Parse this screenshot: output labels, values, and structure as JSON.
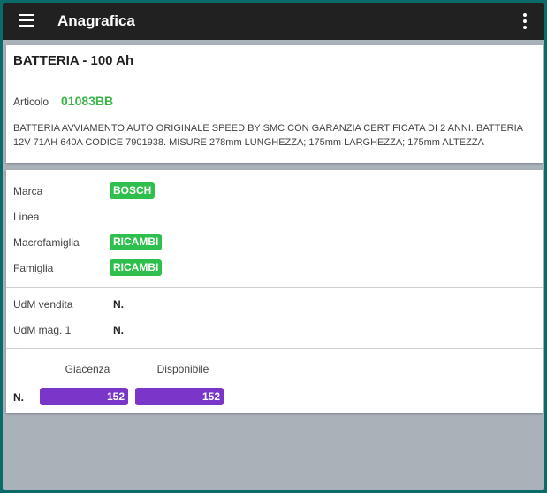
{
  "appbar": {
    "title": "Anagrafica",
    "menu_icon": "hamburger-menu-icon",
    "more_icon": "more-vertical-icon",
    "background": "#212121"
  },
  "product": {
    "title": "BATTERIA - 100 Ah",
    "article_label": "Articolo",
    "article_code": "01083BB",
    "description": "BATTERIA AVVIAMENTO AUTO ORIGINALE SPEED BY SMC CON GARANZIA CERTIFICATA DI 2 ANNI. BATTERIA 12V 71AH 640A CODICE 7901938. MISURE 278mm LUNGHEZZA; 175mm LARGHEZZA; 175mm ALTEZZA"
  },
  "classification": [
    {
      "label": "Marca",
      "value": "BOSCH"
    },
    {
      "label": "Linea",
      "value": ""
    },
    {
      "label": "Macrofamiglia",
      "value": "RICAMBI"
    },
    {
      "label": "Famiglia",
      "value": "RICAMBI"
    }
  ],
  "units": [
    {
      "label": "UdM vendita",
      "value": "N."
    },
    {
      "label": "UdM mag. 1",
      "value": "N."
    }
  ],
  "stock": {
    "unit": "N.",
    "headers": [
      "Giacenza",
      "Disponibile"
    ],
    "values": [
      "152",
      "152"
    ]
  },
  "colors": {
    "accent_green": "#2fbf4c",
    "code_green": "#3cb44b",
    "stock_purple": "#7a35c9",
    "background": "#a9b1b9"
  }
}
